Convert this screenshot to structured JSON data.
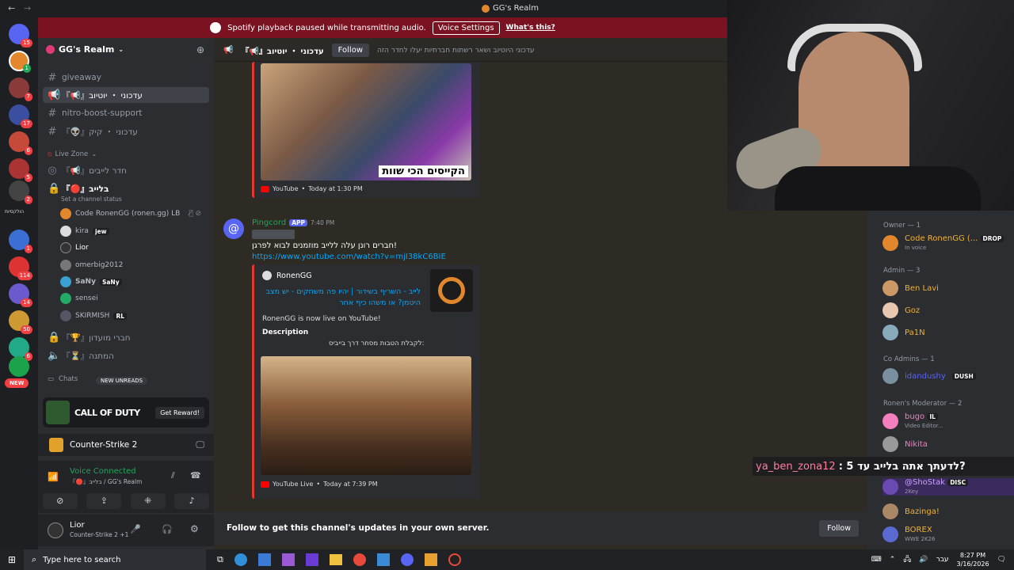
{
  "window": {
    "title": "GG's Realm"
  },
  "notice": {
    "text": "Spotify playback paused while transmitting audio.",
    "voice_settings": "Voice Settings",
    "whats_this": "What's this?"
  },
  "server": {
    "name": "GG's Realm"
  },
  "rail_badges": [
    "15",
    "1",
    "7",
    "17",
    "6",
    "5",
    "2",
    "1",
    "114",
    "14",
    "50",
    "6",
    "NEW"
  ],
  "rail_label": "הולקסיות",
  "channels": [
    {
      "name": "giveaway"
    },
    {
      "name": "『📢』עדכוני ・ יוטיוב"
    },
    {
      "name": "nitro-boost-support"
    },
    {
      "name": "『👽』עדכוני ・ קיק"
    }
  ],
  "live_zone": {
    "label": "Live Zone",
    "voice1": "『📢』חדר לייבים",
    "voice2": "『🔴』בלייב",
    "status": "Set a channel status"
  },
  "voice_users": [
    {
      "name": "Code RonenGG (ronen.gg) LB",
      "color": "#b5bac1"
    },
    {
      "name": "kira",
      "tag": "jew"
    },
    {
      "name": "Lior"
    },
    {
      "name": "omerbig2012"
    },
    {
      "name": "SaNy",
      "tag": "SaNy"
    },
    {
      "name": "sensei"
    },
    {
      "name": "SKIRMISH",
      "tag": "RL"
    }
  ],
  "more_channels": [
    "『🏆』חברי מועדון",
    "『⏳』המתנה"
  ],
  "chats": {
    "label": "Chats",
    "new_unreads": "NEW UNREADS"
  },
  "promo": {
    "title": "CALL OF DUTY",
    "button": "Get Reward!"
  },
  "activity": {
    "game": "Counter-Strike 2"
  },
  "voice": {
    "status": "Voice Connected",
    "location": "『🔴』בלייב / GG's Realm"
  },
  "user": {
    "name": "Lior",
    "activity": "Counter-Strike 2 +1"
  },
  "header": {
    "channel": "『📢』עדכוני ・ יוטיוב",
    "follow": "Follow",
    "topic": "עדכוני היוטיוב ושאר רשתות חברתיות יעלו לחדר הזה"
  },
  "message1": {
    "thumb_text": "הקייסים הכי שוות",
    "source": "YouTube",
    "time": "Today at 1:30 PM"
  },
  "message2": {
    "author": "Pingcord",
    "app": "APP",
    "time": "7:40 PM",
    "text": "חברים רונן עלה ללייב מוזמנים לבוא לפרגן!",
    "link": "https://www.youtube.com/watch?v=mjI38kC6BIE",
    "embed_author": "RonenGG",
    "embed_title": "לייב - השריף בשידור | יהיו פה משחקים - יש מצב היטמן? או משהו כיף אחר",
    "embed_desc": "RonenGG is now live on YouTube!",
    "desc_label": "Description",
    "desc_text": "לקבלת הטבות מסחר דרך בייביס:",
    "source": "YouTube Live",
    "footer_time": "Today at 7:39 PM"
  },
  "follow_bar": {
    "text": "Follow to get this channel's updates in your own server.",
    "button": "Follow"
  },
  "members": {
    "groups": [
      {
        "title": "Owner — 1"
      },
      {
        "title": "Admin — 3"
      },
      {
        "title": "Co Admins — 1"
      },
      {
        "title": "Ronen's Moderator — 2"
      }
    ],
    "list": [
      {
        "name": "Code RonenGG (...",
        "tag": "DROP",
        "sub": "In voice",
        "color": "#f0b232"
      },
      {
        "name": "Ben Lavi",
        "color": "#f0b232"
      },
      {
        "name": "Goz",
        "color": "#f0b232"
      },
      {
        "name": "Pa1N",
        "color": "#f0b232"
      },
      {
        "name": "idandushy",
        "tag": "DUSH",
        "color": "#5865f2"
      },
      {
        "name": "bugo",
        "tag": "IL",
        "sub": "Video Editor...",
        "color": "#f47fbf"
      },
      {
        "name": "Nikita",
        "color": "#f47fbf"
      },
      {
        "name": "@ShoStak",
        "tag": "DISC",
        "sub": "2Key",
        "color": "#c9a0ff"
      },
      {
        "name": "Bazinga!",
        "color": "#f0b232"
      },
      {
        "name": "BOREX",
        "sub": "WWE 2K26",
        "color": "#f0b232"
      }
    ]
  },
  "chat_overlay": {
    "user": "ya_ben_zona12",
    "text": ": לדעתך אתה בלייב עד 5?"
  },
  "taskbar": {
    "search": "Type here to search",
    "time": "8:27 PM",
    "date": "3/16/2026",
    "lang": "עבר"
  }
}
